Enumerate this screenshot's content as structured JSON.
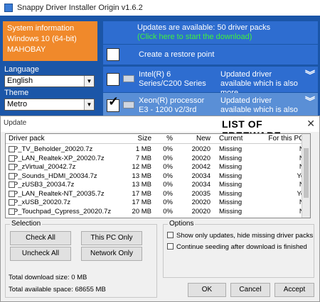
{
  "window": {
    "title": "Snappy Driver Installer Origin v1.6.2"
  },
  "sidebar": {
    "system_info": [
      "System information",
      "Windows 10 (64-bit)",
      "MAHOBAY"
    ],
    "language_label": "Language",
    "language_value": "English",
    "theme_label": "Theme",
    "theme_value": "Metro"
  },
  "main": {
    "updates_text": "Updates are available: 50 driver packs",
    "updates_link": "(Click here to start the download)",
    "restore_point": "Create a restore point",
    "drivers": [
      {
        "name": "Intel(R) 6 Series/C200 Series",
        "status": "Updated driver available which is also more",
        "checked": false
      },
      {
        "name": "Xeon(R) processor E3 - 1200 v2/3rd",
        "status": "Updated driver available which is also more",
        "checked": true
      }
    ]
  },
  "dialog": {
    "title": "Update",
    "watermark": "LIST OF FREEWARE",
    "columns": [
      "Driver pack",
      "Size",
      "%",
      "New",
      "Current",
      "For this PC?"
    ],
    "rows": [
      [
        "DP_TV_Beholder_20020.7z",
        "1 MB",
        "0%",
        "20020",
        "Missing",
        "No"
      ],
      [
        "DP_LAN_Realtek-XP_20020.7z",
        "7 MB",
        "0%",
        "20020",
        "Missing",
        "No"
      ],
      [
        "DP_zVirtual_20042.7z",
        "12 MB",
        "0%",
        "20042",
        "Missing",
        "No"
      ],
      [
        "DP_Sounds_HDMI_20034.7z",
        "13 MB",
        "0%",
        "20034",
        "Missing",
        "Yes"
      ],
      [
        "DP_zUSB3_20034.7z",
        "13 MB",
        "0%",
        "20034",
        "Missing",
        "No"
      ],
      [
        "DP_LAN_Realtek-NT_20035.7z",
        "17 MB",
        "0%",
        "20035",
        "Missing",
        "Yes"
      ],
      [
        "DP_xUSB_20020.7z",
        "17 MB",
        "0%",
        "20020",
        "Missing",
        "No"
      ],
      [
        "DP_Touchpad_Cypress_20020.7z",
        "20 MB",
        "0%",
        "20020",
        "Missing",
        "No"
      ]
    ],
    "selection": {
      "label": "Selection",
      "check_all": "Check All",
      "this_pc_only": "This PC Only",
      "uncheck_all": "Uncheck All",
      "network_only": "Network Only",
      "total_download": "Total download size: 0 MB",
      "total_space": "Total available space: 68655 MB"
    },
    "options": {
      "label": "Options",
      "opt1": "Show only updates, hide missing driver packs",
      "opt2": "Continue seeding after download is finished"
    },
    "buttons": {
      "ok": "OK",
      "cancel": "Cancel",
      "accept": "Accept"
    }
  }
}
